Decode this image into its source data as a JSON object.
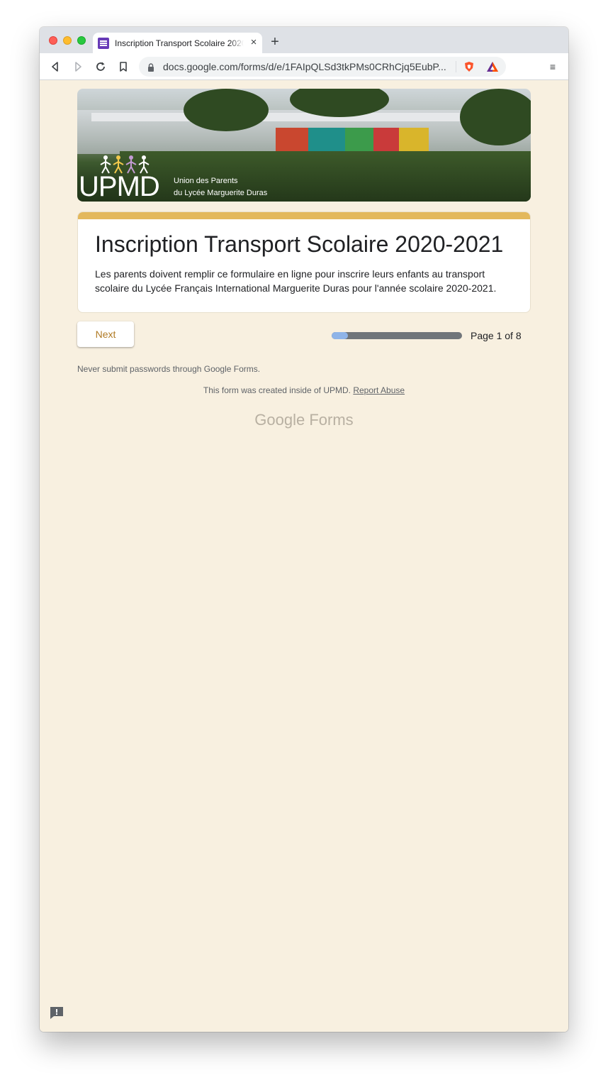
{
  "browser": {
    "tab_title": "Inscription Transport Scolaire 2020-2021",
    "tab_close": "×",
    "new_tab": "+",
    "url": "docs.google.com/forms/d/e/1FAIpQLSd3tkPMs0CRhCjq5EubP...",
    "icons": [
      "back-icon",
      "forward-icon",
      "reload-icon",
      "bookmark-icon",
      "lock-icon",
      "brave-shield-icon",
      "bat-rewards-icon",
      "menu-icon"
    ],
    "menu_glyph": "≡"
  },
  "header_image": {
    "logo_text": "UPMD",
    "logo_line1": "Union des Parents",
    "logo_line2": "du Lycée Marguerite Duras"
  },
  "form": {
    "title": "Inscription Transport Scolaire 2020-2021",
    "description": "Les parents doivent remplir ce formulaire en ligne pour inscrire leurs enfants au transport scolaire du Lycée Français International Marguerite Duras pour l'année scolaire 2020-2021.",
    "accent_color": "#e3b85c",
    "button_text_color": "#b07a24"
  },
  "navigation": {
    "next_label": "Next",
    "progress_fraction": 0.125,
    "page_label": "Page 1 of 8"
  },
  "footer": {
    "warning": "Never submit passwords through Google Forms.",
    "created_text": "This form was created inside of UPMD.",
    "report_link": "Report Abuse",
    "brand": "Google Forms"
  },
  "feedback_icon": "report-icon"
}
